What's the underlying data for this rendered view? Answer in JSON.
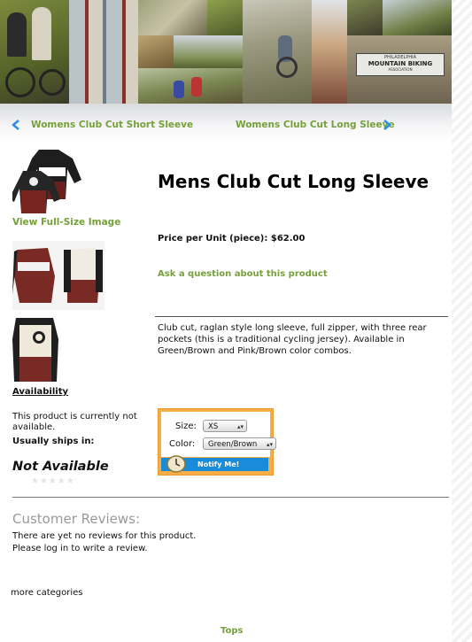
{
  "banner": {
    "sign_line1": "PHILADELPHIA",
    "sign_line2": "MOUNTAIN BIKING",
    "sign_line3": "ASSOCIATION"
  },
  "nav": {
    "prev_label": "Womens Club Cut Short Sleeve",
    "next_label": "Womens Club Cut Long Sleeve",
    "accent": "#76a03a",
    "arrow_color": "#2f8fe0"
  },
  "product": {
    "title": "Mens Club Cut Long Sleeve",
    "view_full_size": "View Full-Size Image",
    "price": "Price per Unit (piece): $62.00",
    "ask": "Ask a question about this product",
    "description": "Club cut, raglan style long sleeve, full zipper, with three rear pockets (this is a traditional cycling jersey). Available in Green/Brown and Pink/Brown color combos."
  },
  "availability": {
    "heading": "Availability",
    "status": "This product is currently not available.",
    "ships_label": "Usually ships in:",
    "not_available": "Not Available",
    "stars": "★★★★★"
  },
  "form": {
    "size_label": "Size:",
    "size_value": "XS",
    "color_label": "Color:",
    "color_value": "Green/Brown",
    "notify_label": "Notify Me!",
    "box_color": "#f6ad46",
    "button_color": "#1a8bd8"
  },
  "reviews": {
    "heading": "Customer Reviews:",
    "line1": "There are yet no reviews for this product.",
    "line2": "Please log in to write a review."
  },
  "footer": {
    "more_categories": "more categories",
    "tops": "Tops"
  }
}
